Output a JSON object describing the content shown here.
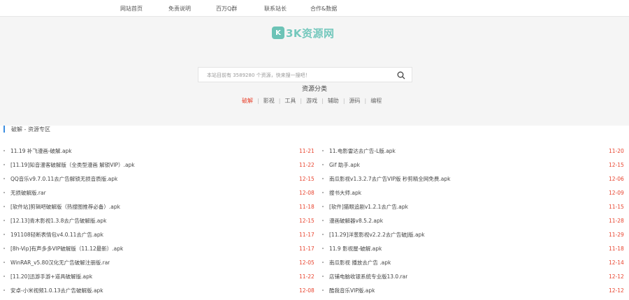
{
  "nav": {
    "items": [
      "网站首页",
      "免责说明",
      "百万Q群",
      "联系站长",
      "合作&数据"
    ]
  },
  "logo": {
    "mark": "K",
    "text": "3K资源网"
  },
  "search": {
    "placeholder": "本站目前有 3589280 个资源，快来搜一搜吧！",
    "icon": "search-icon"
  },
  "categories": {
    "title": "资源分类",
    "items": [
      "破解",
      "影视",
      "工具",
      "游戏",
      "辅助",
      "源码",
      "编程"
    ],
    "active_index": 0
  },
  "section": {
    "title": "破解 - 资源专区",
    "accent": "#3b8de0"
  },
  "colors": {
    "date": "#e8432e",
    "accent": "#75c8bd"
  },
  "left_list": [
    {
      "name": "11.19 补飞漫画-破解.apk",
      "date": "11-21"
    },
    {
      "name": "[11.19]知音漫客破解版（全类型漫画 解锁VIP）.apk",
      "date": "11-22"
    },
    {
      "name": "QQ音乐v9.7.0.11去广告解锁无损音质版.apk",
      "date": "12-15"
    },
    {
      "name": "无损破解版.rar",
      "date": "12-08"
    },
    {
      "name": "[软件站]剪辑吧破解版（热搜图推荐必备）.apk",
      "date": "11-18"
    },
    {
      "name": "[12.13]青木影视1.3.8去广告破解版.apk",
      "date": "12-15"
    },
    {
      "name": "191108轻断表情包v4.0.11去广告.apk",
      "date": "11-17"
    },
    {
      "name": "[8h-Vip]有声多多VIP破解版（11.12最新）.apk",
      "date": "11-17"
    },
    {
      "name": "WinRAR_v5.80汉化无广告破解注册版.rar",
      "date": "12-05"
    },
    {
      "name": "[11.20]迅游手游+道具破解版.apk",
      "date": "11-22"
    },
    {
      "name": "安卓-小米视频1.0.13去广告破解版.apk",
      "date": "12-08"
    }
  ],
  "right_list": [
    {
      "name": "11.电影雷达去广告-L版.apk",
      "date": "11-20"
    },
    {
      "name": "Gif 助手.apk",
      "date": "12-15"
    },
    {
      "name": "南瓜影视v1.3.2.7去广告VIP版 秒剪精全网免费.apk",
      "date": "12-06"
    },
    {
      "name": "搜书大师.apk",
      "date": "12-09"
    },
    {
      "name": "[软件]猫眼追剧v1.2.1去广告.apk",
      "date": "11-15"
    },
    {
      "name": "漫画破解器v8.5.2.apk",
      "date": "11-28"
    },
    {
      "name": "[11.29]洋葱影视v2.2.2去广告破J版.apk",
      "date": "11-29"
    },
    {
      "name": "11.9 影视屋-破解.apk",
      "date": "11-18"
    },
    {
      "name": "南瓜影视 播放去广告 .apk",
      "date": "12-14"
    },
    {
      "name": "店铺电脑收银系统专业版13.0.rar",
      "date": "12-12"
    },
    {
      "name": "酷我音乐VIP版.apk",
      "date": "12-12"
    }
  ]
}
